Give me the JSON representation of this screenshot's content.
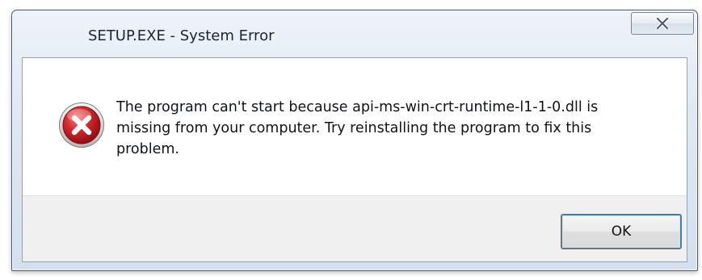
{
  "window": {
    "title": "SETUP.EXE - System Error"
  },
  "message": {
    "line1": "The program can't start because api-ms-win-crt-runtime-l1-1-0.dll is",
    "line2": "missing from your computer. Try reinstalling the program to fix this",
    "line3": "problem."
  },
  "buttons": {
    "ok_label": "OK"
  },
  "icons": {
    "error": "error-icon",
    "close": "close-icon"
  },
  "colors": {
    "error_red": "#c8232a",
    "focus_blue": "#3c7fb1"
  }
}
